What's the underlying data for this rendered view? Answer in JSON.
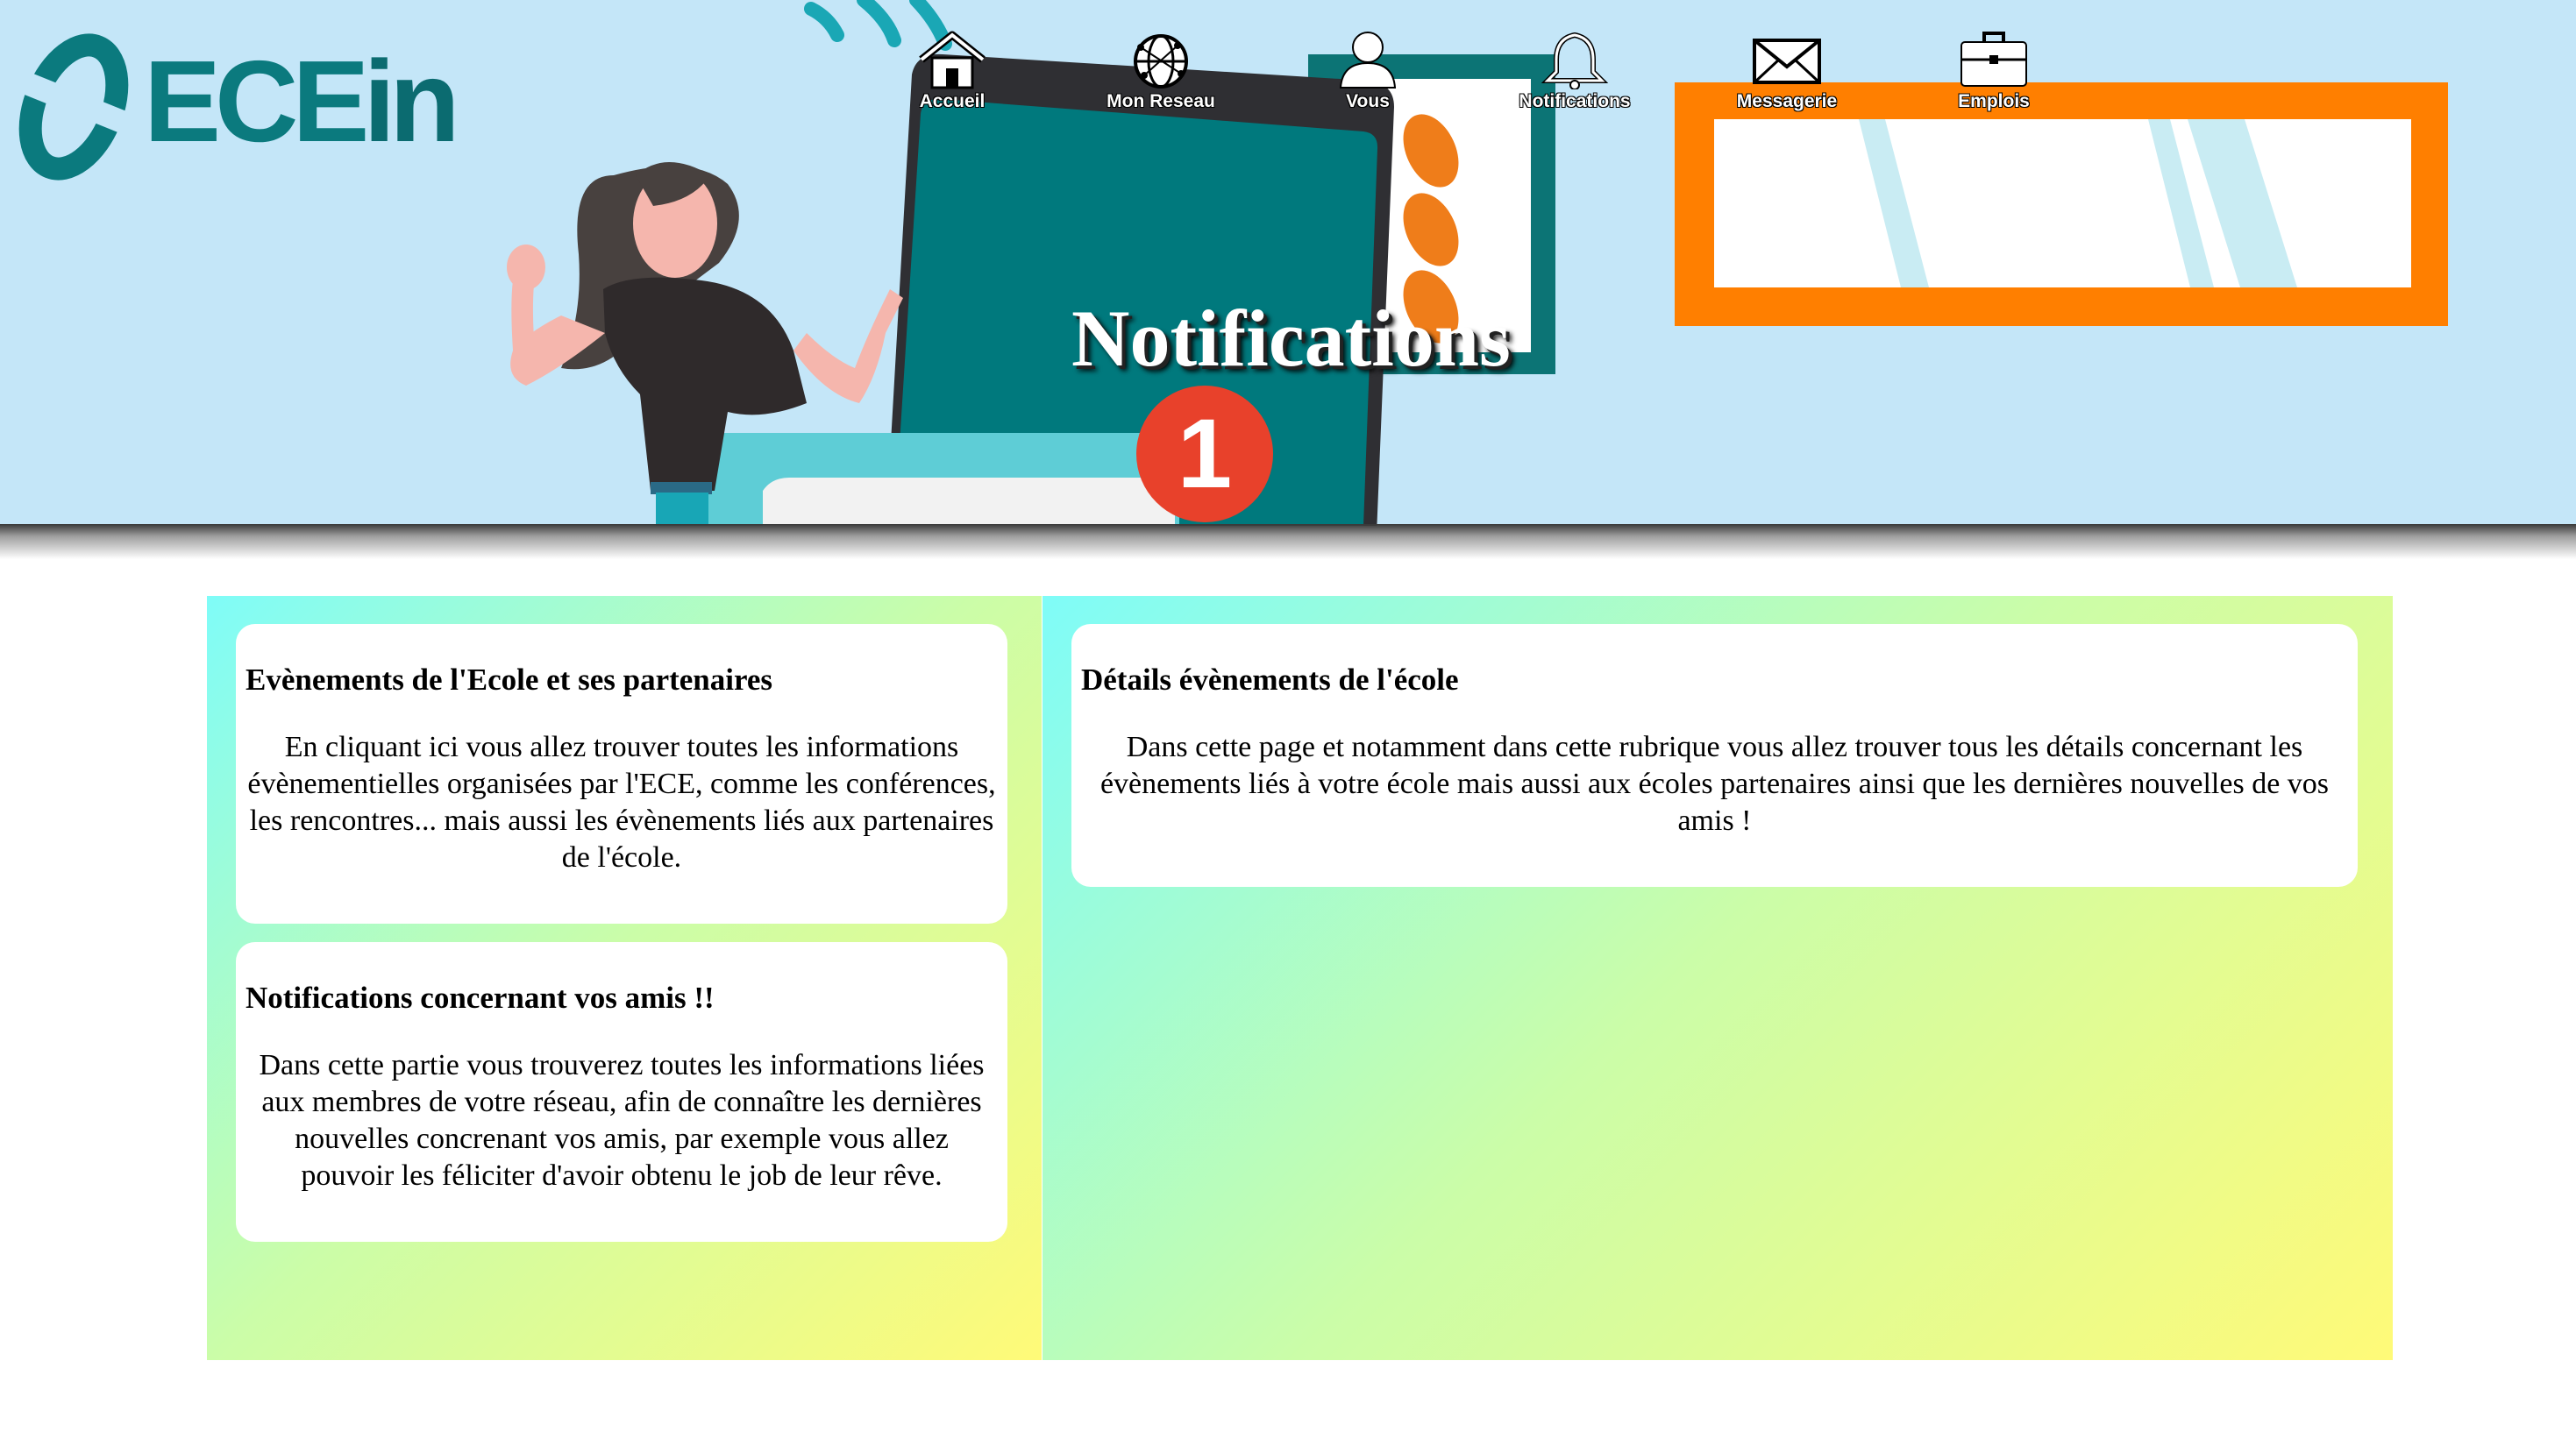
{
  "logo": {
    "text_ece": "ECE",
    "text_in": "in"
  },
  "banner": {
    "title": "Notifications",
    "badge_count": "1"
  },
  "nav": {
    "items": [
      {
        "label": "Accueil",
        "icon": "home-icon"
      },
      {
        "label": "Mon Reseau",
        "icon": "globe-network-icon"
      },
      {
        "label": "Vous",
        "icon": "user-icon"
      },
      {
        "label": "Notifications",
        "icon": "bell-icon"
      },
      {
        "label": "Messagerie",
        "icon": "envelope-icon"
      },
      {
        "label": "Emplois",
        "icon": "briefcase-icon"
      }
    ]
  },
  "left": {
    "card1": {
      "title": "Evènements de l'Ecole et ses partenaires",
      "text": "En cliquant ici vous allez trouver toutes les informations évènementielles organisées par l'ECE, comme les conférences, les rencontres... mais aussi les évènements liés aux partenaires de l'école."
    },
    "card2": {
      "title": "Notifications concernant vos amis !!",
      "text": "Dans cette partie vous trouverez toutes les informations liées aux membres de votre réseau, afin de connaître les dernières nouvelles concrenant vos amis, par exemple vous allez pouvoir les féliciter d'avoir obtenu le job de leur rêve."
    }
  },
  "right": {
    "card1": {
      "title": "Détails évènements de l'école",
      "text": "Dans cette page et notamment dans cette rubrique vous allez trouver tous les détails concernant les évènements liés à votre école mais aussi aux écoles partenaires ainsi que les dernières nouvelles de vos amis !"
    }
  },
  "colors": {
    "banner_bg": "#c4e6f8",
    "brand_teal": "#0b7a7e",
    "accent_orange": "#ff7f00",
    "badge_red": "#e8412b",
    "gradient": [
      "#7ffcf8",
      "#cbfda8",
      "#fffa78"
    ]
  }
}
